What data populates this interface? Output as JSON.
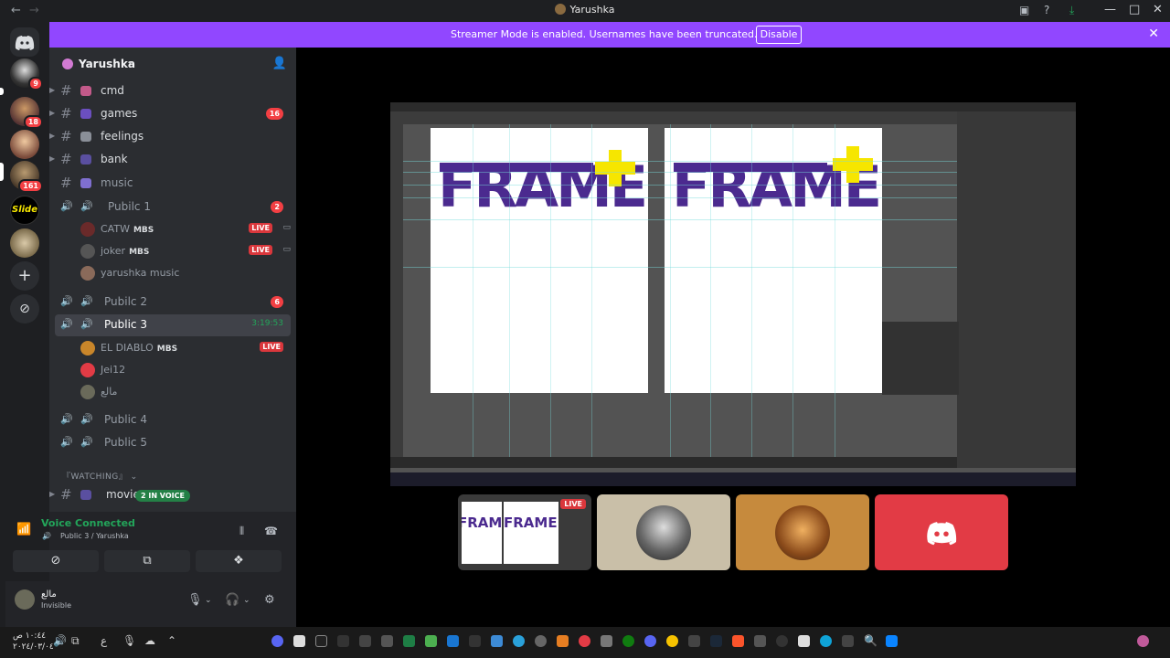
{
  "window": {
    "title": "Yarushka"
  },
  "banner": {
    "text": "Streamer Mode is enabled. Usernames have been truncated.",
    "button": "Disable"
  },
  "rail": {
    "badges": [
      "9",
      "18",
      "161"
    ],
    "slide_label": "Slide"
  },
  "server": {
    "name": "Yarushka"
  },
  "channels": [
    {
      "name": "cmd"
    },
    {
      "name": "games",
      "badge": "16"
    },
    {
      "name": "feelings"
    },
    {
      "name": "bank"
    },
    {
      "name": "music"
    }
  ],
  "voice1": {
    "name": "Pubilc 1",
    "badge": "2",
    "users": [
      {
        "name": "CATW",
        "tag": "MBS",
        "live": "LIVE"
      },
      {
        "name": "joker",
        "tag": "MBS",
        "live": "LIVE"
      },
      {
        "name": "yarushka music"
      }
    ]
  },
  "voice2": {
    "name": "Pubilc 2",
    "badge": "6"
  },
  "voice3": {
    "name": "Public 3",
    "timer": "3:19:53",
    "users": [
      {
        "name": "EL DIABLO",
        "tag": "MBS",
        "live": "LIVE"
      },
      {
        "name": "Jei12"
      },
      {
        "name": "مالع"
      }
    ]
  },
  "voice4": {
    "name": "Public 4"
  },
  "voice5": {
    "name": "Public 5"
  },
  "category": {
    "name": "『WATCHING』"
  },
  "movie_channel": {
    "name": "movie",
    "in_voice": "2 IN VOICE"
  },
  "voice_panel": {
    "title": "Voice Connected",
    "subtitle": "Public 3 / Yarushka"
  },
  "userbar": {
    "name": "مالع",
    "status": "Invisible"
  },
  "stream": {
    "logo_text": "FRAME",
    "tile_live": "LIVE",
    "colors": {
      "logo_purple": "#4b2a8f",
      "logo_yellow": "#f6e600"
    }
  },
  "taskbar": {
    "time": "١٠:٤٤ ص",
    "date": "٢٠٢٤/٠٣/٠٤",
    "lang": "ع"
  },
  "colors": {
    "banner": "#9147ff",
    "live": "#da373c",
    "voice_green": "#23a55a",
    "discord_blurple": "#5865f2",
    "tile_red": "#e23b45"
  }
}
